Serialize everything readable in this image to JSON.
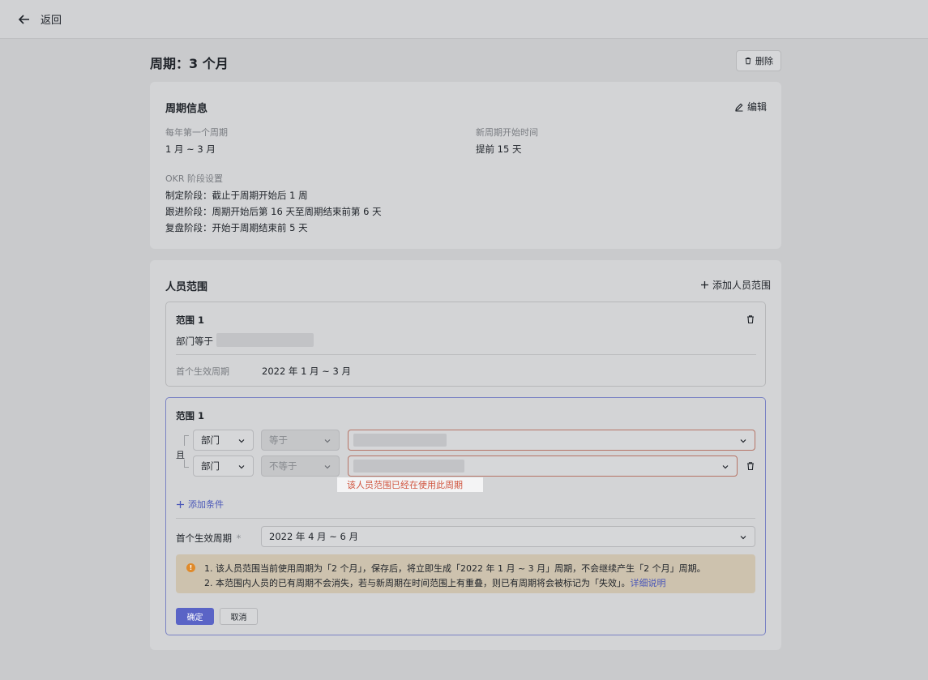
{
  "topbar": {
    "back_label": "返回",
    "back_icon": "arrow-left-icon"
  },
  "page": {
    "title": "周期：3 个月",
    "delete_label": "删除"
  },
  "cycle_info": {
    "title": "周期信息",
    "edit_label": "编辑",
    "first_cycle_label": "每年第一个周期",
    "first_cycle_value": "1 月 ~ 3 月",
    "new_cycle_start_label": "新周期开始时间",
    "new_cycle_start_value": "提前 15 天",
    "okr_stage_label": "OKR 阶段设置",
    "stages": [
      "制定阶段：截止于周期开始后 1 周",
      "跟进阶段：周期开始后第 16 天至周期结束前第 6 天",
      "复盘阶段：开始于周期结束前 5 天"
    ]
  },
  "scope": {
    "title": "人员范围",
    "add_label": "添加人员范围",
    "existing": {
      "title": "范围 1",
      "condition_label": "部门等于",
      "first_cycle_label": "首个生效周期",
      "first_cycle_value": "2022 年 1 月 ~ 3 月"
    },
    "editing": {
      "title": "范围 1",
      "and_label": "且",
      "row1": {
        "field": "部门",
        "operator": "等于"
      },
      "row2": {
        "field": "部门",
        "operator": "不等于"
      },
      "error_tip": "该人员范围已经在使用此周期",
      "add_condition_label": "添加条件",
      "first_cycle_label": "首个生效周期",
      "required_mark": "*",
      "first_cycle_value": "2022 年 4 月 ~ 6 月",
      "notice_line1": "1. 该人员范围当前使用周期为「2 个月」，保存后，将立即生成「2022 年 1 月 ~ 3 月」周期，不会继续产生「2 个月」周期。",
      "notice_line2": "2. 本范围内人员的已有周期不会消失，若与新周期在时间范围上有重叠，则已有周期将会被标记为「失效」。",
      "notice_more": "详细说明",
      "confirm_label": "确定",
      "cancel_label": "取消"
    }
  },
  "colors": {
    "primary": "#5a64c6",
    "error": "#d0553f",
    "warning": "#e08a2a"
  }
}
